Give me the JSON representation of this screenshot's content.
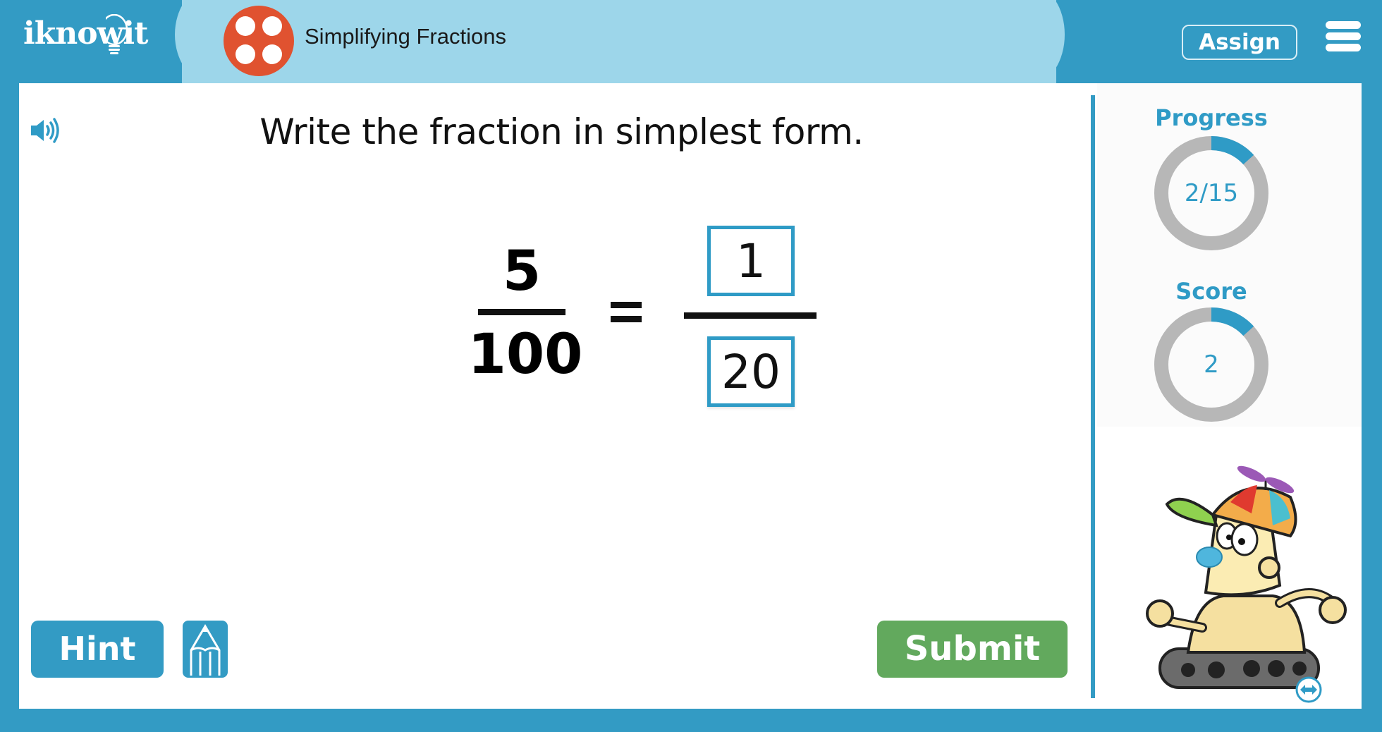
{
  "header": {
    "logo_text": "iknowit",
    "lesson_title": "Simplifying Fractions",
    "lesson_icon": "four-dots-icon",
    "assign_label": "Assign",
    "menu_icon": "hamburger-menu-icon"
  },
  "question": {
    "audio_icon": "speaker-icon",
    "prompt": "Write the fraction in simplest form.",
    "given_fraction": {
      "numerator": "5",
      "denominator": "100"
    },
    "equals_sign": "=",
    "answer": {
      "numerator": "1",
      "denominator": "20"
    }
  },
  "actions": {
    "hint_label": "Hint",
    "scratchpad_icon": "pencil-icon",
    "submit_label": "Submit"
  },
  "sidebar": {
    "progress": {
      "label": "Progress",
      "value_text": "2/15",
      "current": 2,
      "total": 15,
      "fraction": 0.1333
    },
    "score": {
      "label": "Score",
      "value_text": "2",
      "fraction": 0.1333
    },
    "mascot": "robot-mascot",
    "resize_icon": "resize-horizontal-icon"
  },
  "colors": {
    "primary_blue": "#339bc4",
    "header_pill": "#9dd6ea",
    "lesson_icon_orange": "#e05230",
    "submit_green": "#62a95d",
    "ring_gray": "#b7b7b7"
  }
}
